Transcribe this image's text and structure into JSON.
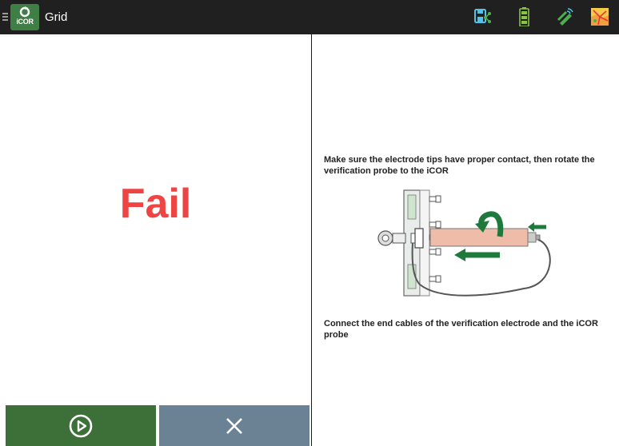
{
  "header": {
    "logo_text": "iCOR",
    "title": "Grid",
    "status_icons": [
      "save-share-icon",
      "battery-icon",
      "wireless-probe-icon",
      "map-icon"
    ]
  },
  "left": {
    "result": "Fail",
    "result_color": "#ee4444",
    "play_button_icon": "play-circle-icon",
    "close_button_icon": "close-icon"
  },
  "right": {
    "instruction_1": "Make sure the electrode tips have proper contact, then rotate the verification probe to the iCOR",
    "instruction_2": "Connect the end cables of the verification electrode and the iCOR probe",
    "diagram_icon": "probe-connection-illustration"
  },
  "colors": {
    "topbar": "#202020",
    "play_button": "#3d7038",
    "close_button": "#6a8293",
    "accent_green": "#1e7a3c"
  }
}
